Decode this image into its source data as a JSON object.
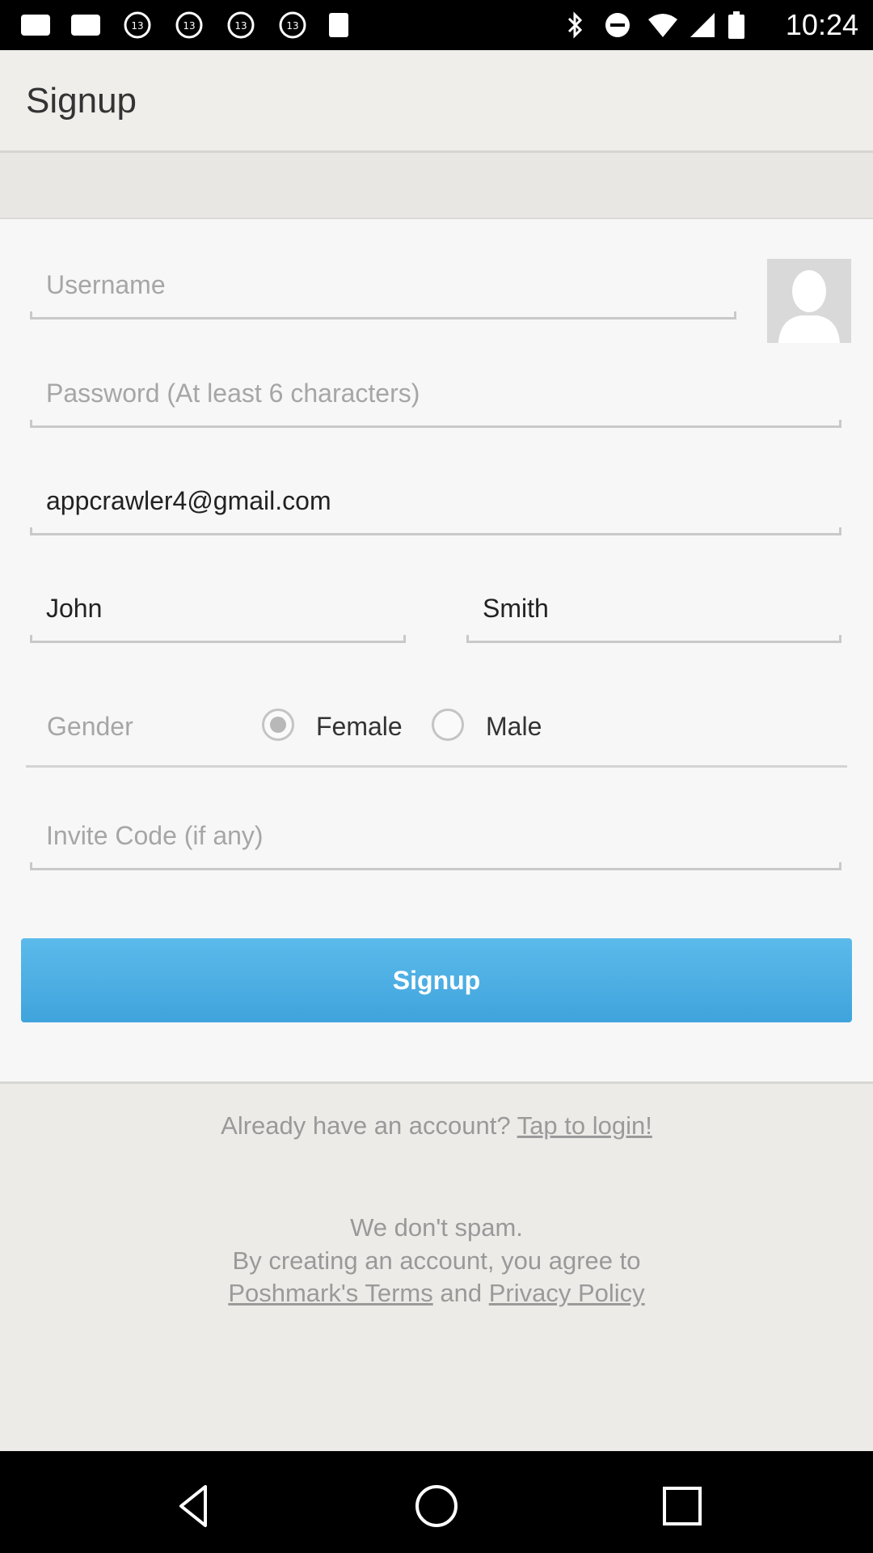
{
  "status_bar": {
    "time": "10:24",
    "left_icons": [
      "photo-icon",
      "photo-icon",
      "abc13-icon",
      "abc13-icon",
      "abc13-icon",
      "abc13-icon",
      "app-icon"
    ],
    "right_icons": [
      "bluetooth-icon",
      "dnd-icon",
      "wifi-icon",
      "cellular-icon",
      "battery-icon"
    ]
  },
  "app_bar": {
    "title": "Signup"
  },
  "form": {
    "username_placeholder": "Username",
    "password_placeholder": "Password (At least 6 characters)",
    "email_value": "appcrawler4@gmail.com",
    "first_name_value": "John",
    "last_name_value": "Smith",
    "gender_label": "Gender",
    "gender_options": [
      {
        "label": "Female",
        "selected": true
      },
      {
        "label": "Male",
        "selected": false
      }
    ],
    "invite_placeholder": "Invite Code (if any)",
    "signup_button": "Signup"
  },
  "footer": {
    "login_prompt": "Already have an account?",
    "login_link": "Tap to login!",
    "spam_line": "We don't spam.",
    "agree_line": "By creating an account, you agree to",
    "terms_link": "Poshmark's Terms",
    "and_text": "and",
    "privacy_link": "Privacy Policy"
  },
  "colors": {
    "accent": "#4aaee3",
    "placeholder": "#a6a6a6"
  },
  "nav_bar": {
    "buttons": [
      "back-icon",
      "home-icon",
      "recents-icon"
    ]
  }
}
